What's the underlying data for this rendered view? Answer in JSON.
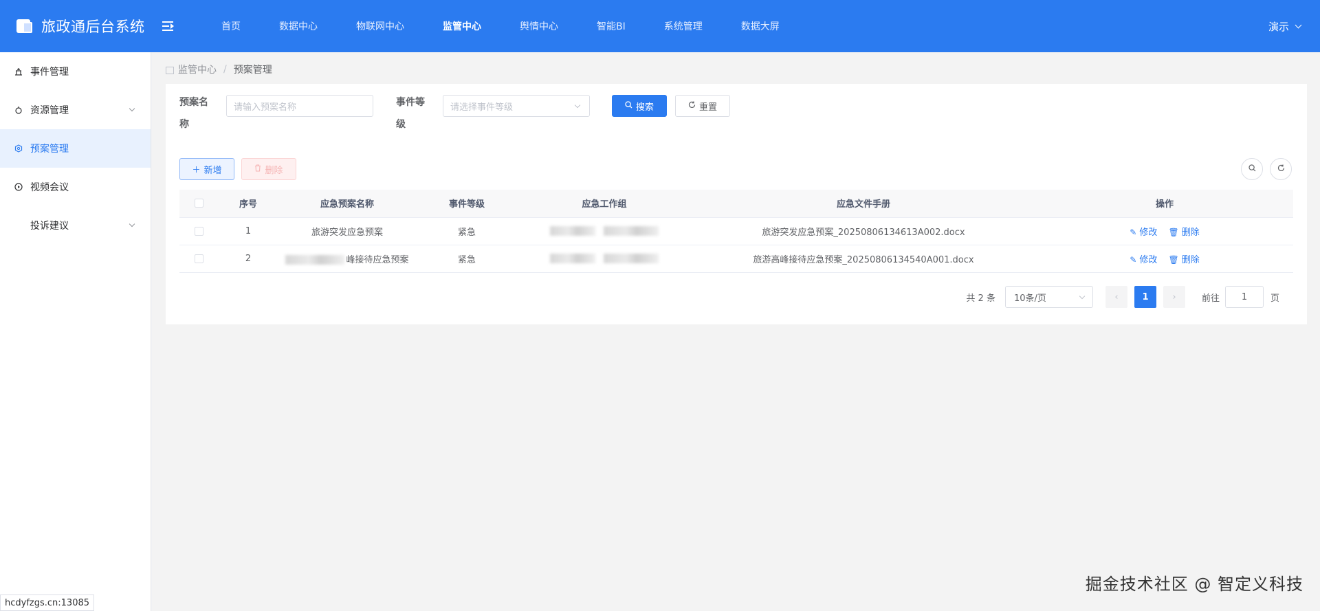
{
  "app": {
    "title": "旅政通后台系统"
  },
  "topnav": [
    {
      "label": "首页",
      "active": false
    },
    {
      "label": "数据中心",
      "active": false
    },
    {
      "label": "物联网中心",
      "active": false
    },
    {
      "label": "监管中心",
      "active": true
    },
    {
      "label": "舆情中心",
      "active": false
    },
    {
      "label": "智能BI",
      "active": false
    },
    {
      "label": "系统管理",
      "active": false
    },
    {
      "label": "数据大屏",
      "active": false
    }
  ],
  "user": {
    "name": "演示"
  },
  "sidebar": {
    "items": [
      {
        "label": "事件管理",
        "icon": "event-icon"
      },
      {
        "label": "资源管理",
        "icon": "resource-icon"
      },
      {
        "label": "预案管理",
        "icon": "plan-icon"
      },
      {
        "label": "视频会议",
        "icon": "video-icon"
      },
      {
        "label": "投诉建议"
      }
    ]
  },
  "breadcrumb": {
    "parent": "监管中心",
    "current": "预案管理",
    "separator": "/"
  },
  "search": {
    "name_label_1": "预案名",
    "name_label_2": "称",
    "name_placeholder": "请输入预案名称",
    "level_label_1": "事件等",
    "level_label_2": "级",
    "level_placeholder": "请选择事件等级",
    "search_btn": "搜索",
    "reset_btn": "重置"
  },
  "toolbar": {
    "add_btn": "新增",
    "delete_btn": "删除"
  },
  "table": {
    "columns": [
      "序号",
      "应急预案名称",
      "事件等级",
      "应急工作组",
      "应急文件手册",
      "操作"
    ],
    "rows": [
      {
        "index": "1",
        "name": "旅游突发应急预案",
        "level": "紧急",
        "file": "旅游突发应急预案_20250806134613A002.docx"
      },
      {
        "index": "2",
        "name": "峰接待应急预案",
        "level": "紧急",
        "file": "旅游高峰接待应急预案_20250806134540A001.docx"
      }
    ],
    "edit_label": "修改",
    "delete_label": "删除"
  },
  "pagination": {
    "total": "共 2 条",
    "page_size": "10条/页",
    "current": "1",
    "goto_label": "前往",
    "goto_value": "1",
    "page_suffix": "页"
  },
  "status_url": "hcdyfzgs.cn:13085",
  "watermark": "掘金技术社区 @ 智定义科技",
  "colors": {
    "primary": "#2b7bf0"
  }
}
